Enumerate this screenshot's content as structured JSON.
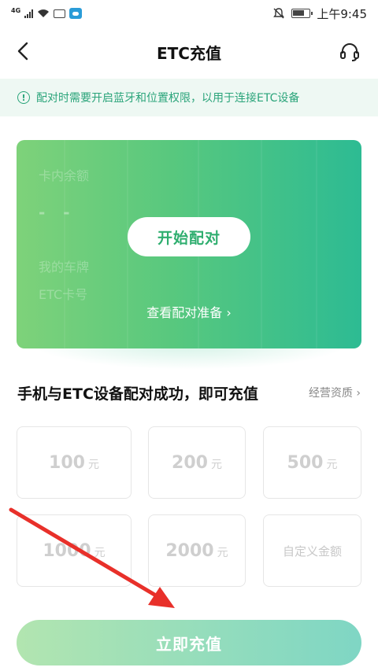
{
  "status_bar": {
    "network_tag": "4G",
    "time": "上午9:45"
  },
  "nav": {
    "title": "ETC充值"
  },
  "notice": {
    "icon": "info-icon",
    "text": "配对时需要开启蓝牙和位置权限，以用于连接ETC设备"
  },
  "card": {
    "balance_label": "卡内余额",
    "balance_value": "- -",
    "plate_label": "我的车牌",
    "card_no_label": "ETC卡号",
    "pair_button": "开始配对",
    "prep_link": "查看配对准备 ›"
  },
  "recharge": {
    "title": "手机与ETC设备配对成功，即可充值",
    "qualification_link": "经营资质 ›",
    "amounts": [
      {
        "value": "100",
        "unit": "元"
      },
      {
        "value": "200",
        "unit": "元"
      },
      {
        "value": "500",
        "unit": "元"
      },
      {
        "value": "1000",
        "unit": "元"
      },
      {
        "value": "2000",
        "unit": "元"
      }
    ],
    "custom_label": "自定义金额",
    "submit": "立即充值"
  },
  "colors": {
    "accent": "#2fae6f",
    "card_start": "#7ed27a",
    "card_end": "#2dbb93",
    "annotation_arrow": "#e8302a"
  }
}
